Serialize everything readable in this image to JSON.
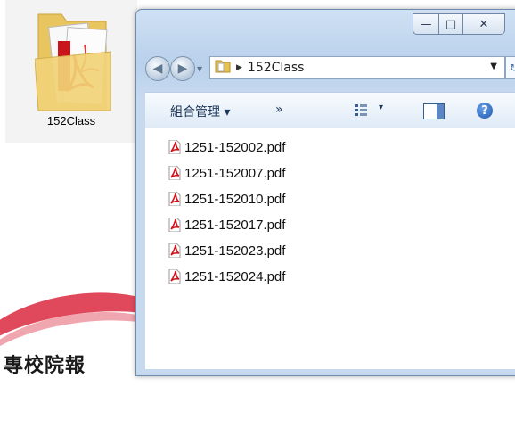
{
  "desktop": {
    "folder_label": "152Class",
    "bottom_text": "專校院報"
  },
  "window": {
    "controls": {
      "minimize": "—",
      "maximize": "□",
      "close": "✕"
    },
    "address": {
      "path": "152Class"
    },
    "toolbar": {
      "organize_label": "組合管理 ▾",
      "more_label": "»",
      "views_drop": "▾",
      "help_label": "?"
    },
    "files": [
      {
        "name": "1251-152002.pdf"
      },
      {
        "name": "1251-152007.pdf"
      },
      {
        "name": "1251-152010.pdf"
      },
      {
        "name": "1251-152017.pdf"
      },
      {
        "name": "1251-152023.pdf"
      },
      {
        "name": "1251-152024.pdf"
      }
    ]
  }
}
